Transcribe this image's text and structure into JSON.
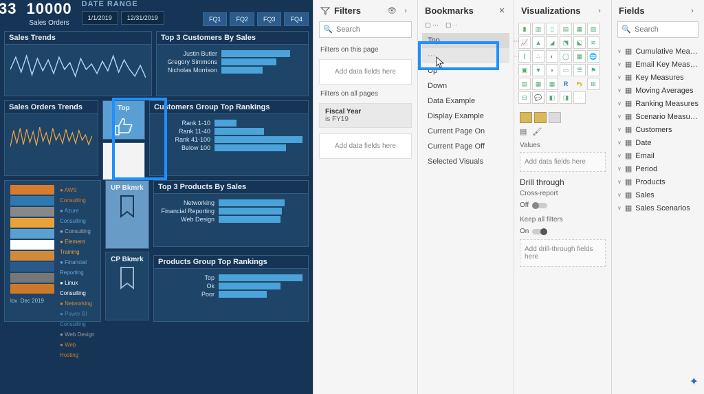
{
  "header": {
    "metric1_value": "33",
    "metric2_value": "10000",
    "metric2_label": "Sales Orders",
    "date_range_title": "DATE RANGE",
    "date_from": "1/1/2019",
    "date_to": "12/31/2019",
    "fq": [
      "FQ1",
      "FQ2",
      "FQ3",
      "FQ4"
    ]
  },
  "cards": {
    "sales_trends": "Sales Trends",
    "top3_customers": "Top 3 Customers By Sales",
    "sales_orders_trends": "Sales Orders Trends",
    "cust_group_rank": "Customers Group Top Rankings",
    "top3_products": "Top 3 Products By Sales",
    "prod_group_rank": "Products Group Top Rankings"
  },
  "bkmk": {
    "top": "Top",
    "up": "UP Bkmrk",
    "cp": "CP Bkmrk"
  },
  "timeline": {
    "m1": "lov",
    "m2": "Dec 2019"
  },
  "legend": [
    "AWS Consulting",
    "Azure Consulting",
    "Consulting",
    "Element Training",
    "Financial Reporting",
    "Linux Consulting",
    "Networking",
    "Power BI Consulting",
    "Web Design",
    "Web Hosting"
  ],
  "chart_data": {
    "top3_customers": {
      "type": "bar",
      "categories": [
        "Justin Butler",
        "Gregory Simmons",
        "Nicholas Morrison"
      ],
      "values": [
        100,
        80,
        60
      ]
    },
    "customers_group_rank": {
      "type": "bar",
      "categories": [
        "Rank 1-10",
        "Rank 11-40",
        "Rank 41-100",
        "Below 100"
      ],
      "values": [
        25,
        55,
        100,
        80
      ]
    },
    "top3_products": {
      "type": "bar",
      "categories": [
        "Networking",
        "Financial Reporting",
        "Web Design"
      ],
      "values": [
        75,
        72,
        70
      ]
    },
    "products_group_rank": {
      "type": "bar",
      "categories": [
        "Top",
        "Ok",
        "Poor"
      ],
      "values": [
        95,
        70,
        55
      ]
    }
  },
  "filters": {
    "title": "Filters",
    "search_ph": "Search",
    "on_page": "Filters on this page",
    "add_here": "Add data fields here",
    "all_pages": "Filters on all pages",
    "fy_name": "Fiscal Year",
    "fy_val": "is FY19"
  },
  "bookmarks": {
    "title": "Bookmarks",
    "items": [
      "Top",
      "Up",
      "Down",
      "Data Example",
      "Display Example",
      "Current Page On",
      "Current Page Off",
      "Selected Visuals"
    ]
  },
  "viz": {
    "title": "Visualizations",
    "values_label": "Values",
    "add_fields": "Add data fields here",
    "drill_title": "Drill through",
    "cross_report": "Cross-report",
    "off": "Off",
    "keep_filters": "Keep all filters",
    "on": "On",
    "add_drill": "Add drill-through fields here"
  },
  "fields": {
    "title": "Fields",
    "search_ph": "Search",
    "tables": [
      "Cumulative Meas...",
      "Email Key Measur...",
      "Key Measures",
      "Moving Averages",
      "Ranking Measures",
      "Scenario Measures",
      "Customers",
      "Date",
      "Email",
      "Period",
      "Products",
      "Sales",
      "Sales Scenarios"
    ]
  }
}
